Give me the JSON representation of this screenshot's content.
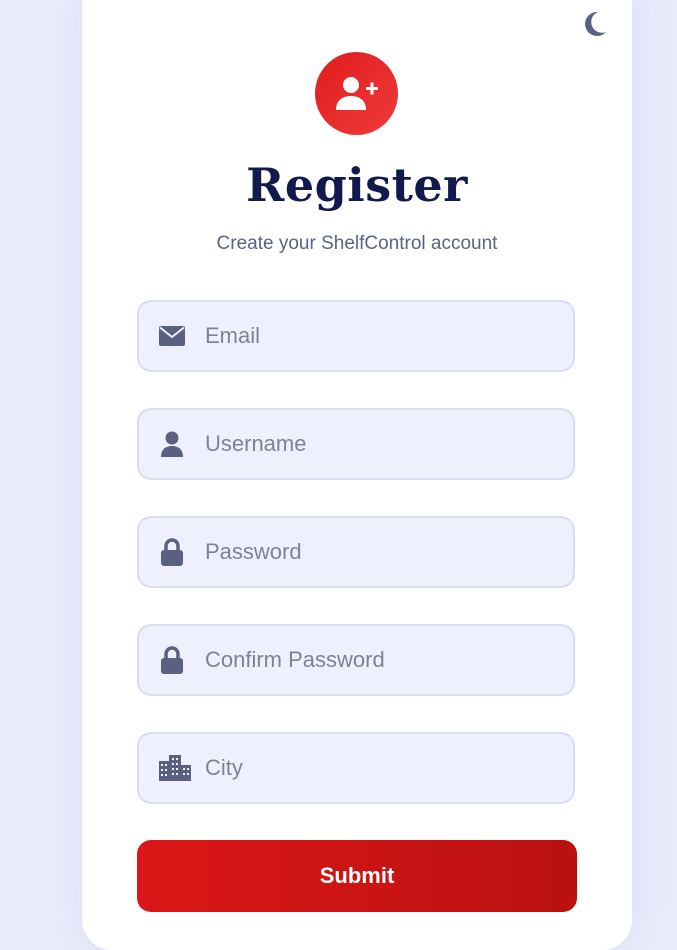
{
  "theme": {
    "accent": "#e11d1d",
    "title_color": "#121a4d",
    "icon_color": "#5a6080",
    "toggle_icon": "moon-icon"
  },
  "header": {
    "badge_icon": "user-plus-icon",
    "title": "Register",
    "subtitle": "Create your ShelfControl account"
  },
  "form": {
    "fields": [
      {
        "icon": "envelope-icon",
        "placeholder": "Email",
        "value": ""
      },
      {
        "icon": "user-icon",
        "placeholder": "Username",
        "value": ""
      },
      {
        "icon": "lock-icon",
        "placeholder": "Password",
        "value": ""
      },
      {
        "icon": "lock-icon",
        "placeholder": "Confirm Password",
        "value": ""
      },
      {
        "icon": "city-icon",
        "placeholder": "City",
        "value": ""
      }
    ],
    "submit_label": "Submit"
  }
}
